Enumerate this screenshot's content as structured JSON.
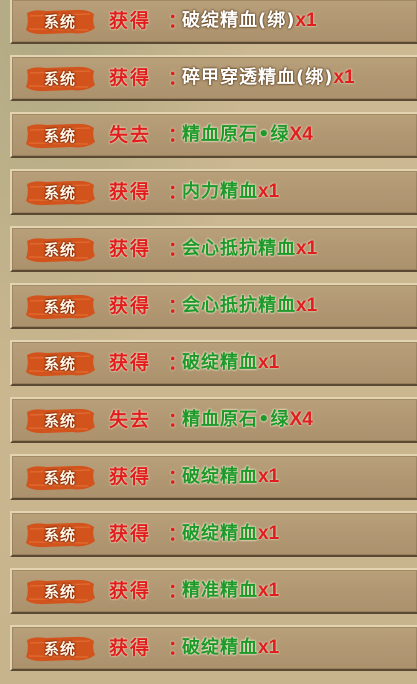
{
  "colors": {
    "badge_fill": "#d2541c",
    "action_red": "#e01e1e",
    "item_white": "#ffffff",
    "item_green": "#1e9a2a",
    "row_bg": "#b19873"
  },
  "log": {
    "entries": [
      {
        "tag": "系统",
        "action": "获得",
        "colon": "：",
        "item": "破绽精血(绑)",
        "item_color": "white",
        "qty": "x1"
      },
      {
        "tag": "系统",
        "action": "获得",
        "colon": "：",
        "item": "碎甲穿透精血(绑)",
        "item_color": "white",
        "qty": "x1"
      },
      {
        "tag": "系统",
        "action": "失去",
        "colon": "：",
        "item": "精血原石•绿",
        "item_color": "green",
        "qty": "X4"
      },
      {
        "tag": "系统",
        "action": "获得",
        "colon": "：",
        "item": "内力精血",
        "item_color": "green",
        "qty": "x1"
      },
      {
        "tag": "系统",
        "action": "获得",
        "colon": "：",
        "item": "会心抵抗精血",
        "item_color": "green",
        "qty": "x1"
      },
      {
        "tag": "系统",
        "action": "获得",
        "colon": "：",
        "item": "会心抵抗精血",
        "item_color": "green",
        "qty": "x1"
      },
      {
        "tag": "系统",
        "action": "获得",
        "colon": "：",
        "item": "破绽精血",
        "item_color": "green",
        "qty": "x1"
      },
      {
        "tag": "系统",
        "action": "失去",
        "colon": "：",
        "item": "精血原石•绿",
        "item_color": "green",
        "qty": "X4"
      },
      {
        "tag": "系统",
        "action": "获得",
        "colon": "：",
        "item": "破绽精血",
        "item_color": "green",
        "qty": "x1"
      },
      {
        "tag": "系统",
        "action": "获得",
        "colon": "：",
        "item": "破绽精血",
        "item_color": "green",
        "qty": "x1"
      },
      {
        "tag": "系统",
        "action": "获得",
        "colon": "：",
        "item": "精准精血",
        "item_color": "green",
        "qty": "x1"
      },
      {
        "tag": "系统",
        "action": "获得",
        "colon": "：",
        "item": "破绽精血",
        "item_color": "green",
        "qty": "x1"
      }
    ]
  }
}
